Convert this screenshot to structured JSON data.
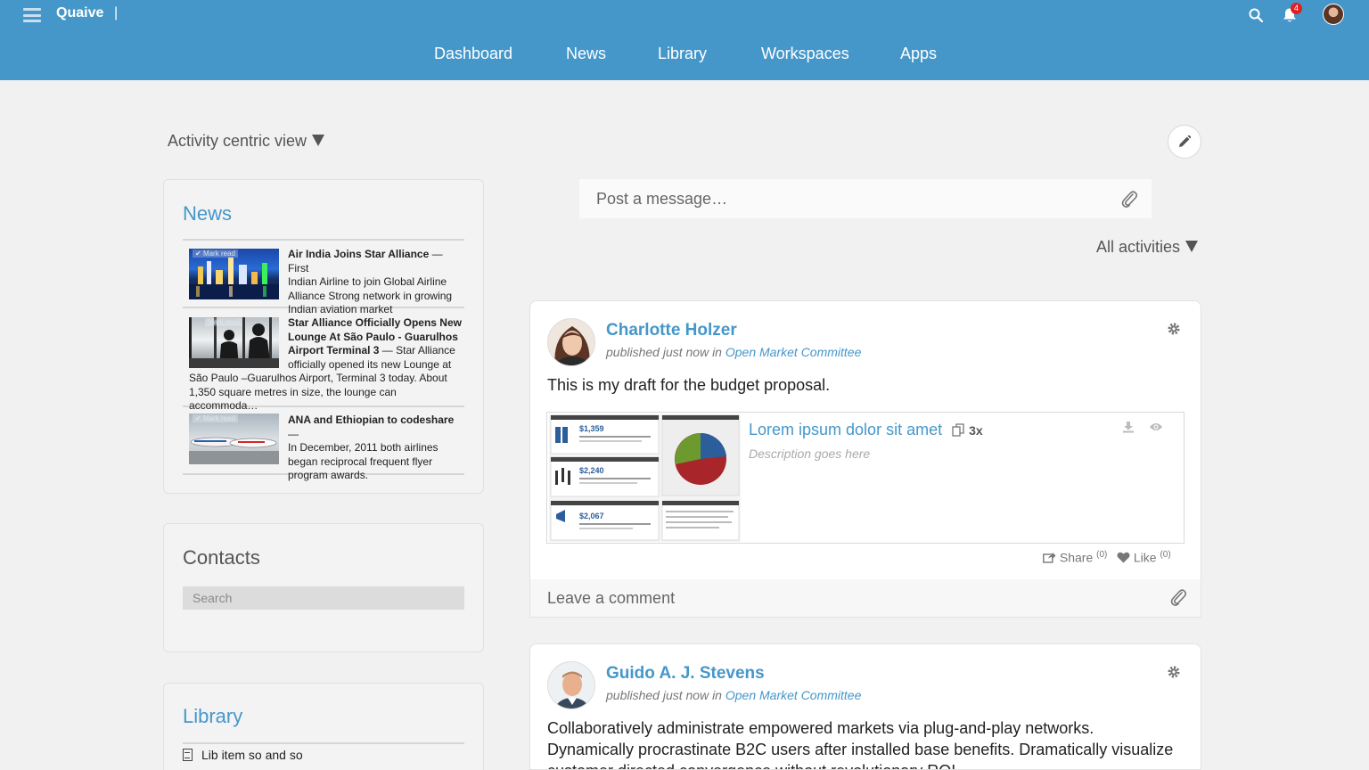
{
  "header": {
    "brand": "Quaive",
    "separator": "|",
    "notification_count": "4",
    "nav": [
      {
        "label": "Dashboard"
      },
      {
        "label": "News"
      },
      {
        "label": "Library"
      },
      {
        "label": "Workspaces"
      },
      {
        "label": "Apps"
      }
    ]
  },
  "left": {
    "view_selector": "Activity centric view",
    "news": {
      "title": "News",
      "mark_read": "Mark read",
      "items": [
        {
          "title": "Air India Joins Star Alliance",
          "dash": " — ",
          "body_lines": [
            "First",
            "Indian Airline to join Global Airline",
            "Alliance Strong network in growing",
            "Indian aviation market"
          ]
        },
        {
          "title_lines": [
            "Star Alliance Officially Opens New",
            "Lounge At São Paulo - Guarulhos",
            "Airport Terminal 3"
          ],
          "dash": " — ",
          "body_lines": [
            "Star Alliance",
            "officially opened its new Lounge at",
            "São Paulo –Guarulhos Airport, Terminal 3 today. About",
            "1,350 square metres in size, the lounge can accommoda…"
          ]
        },
        {
          "title": "ANA and Ethiopian to codeshare",
          "dash": " — ",
          "body_lines": [
            "In December, 2011 both airlines",
            "began reciprocal frequent flyer",
            "program awards."
          ]
        }
      ]
    },
    "contacts": {
      "title": "Contacts",
      "search_placeholder": "Search"
    },
    "library": {
      "title": "Library",
      "item": "Lib item so and so"
    }
  },
  "stream": {
    "post_placeholder": "Post a message…",
    "filter": "All activities",
    "posts": [
      {
        "author": "Charlotte Holzer",
        "meta_prefix": "published just now in ",
        "workspace": "Open Market Committee",
        "body": "This is my draft for the budget proposal.",
        "attachment": {
          "title": "Lorem ipsum dolor sit amet",
          "count": "3x",
          "description": "Description goes here",
          "preview_values": [
            "$1,359",
            "$2,240",
            "$2,067"
          ]
        },
        "share_label": "Share",
        "share_count": "(0)",
        "like_label": "Like",
        "like_count": "(0)",
        "comment_placeholder": "Leave a comment"
      },
      {
        "author": "Guido A. J. Stevens",
        "meta_prefix": "published just now in ",
        "workspace": "Open Market Committee",
        "body_lines": [
          "Collaboratively administrate empowered markets via plug-and-play networks.",
          "Dynamically procrastinate B2C users after installed base benefits. Dramatically visualize",
          "customer directed convergence without revolutionary ROI."
        ]
      }
    ]
  },
  "colors": {
    "header": "#4597ca",
    "accent": "#4597ca",
    "background": "#f1f1f1",
    "badge": "#e02020"
  },
  "icons": [
    "hamburger-icon",
    "search-icon",
    "bell-icon",
    "pencil-icon",
    "paperclip-icon",
    "gear-icon",
    "download-icon",
    "eye-icon",
    "share-icon",
    "heart-icon",
    "document-icon",
    "copies-icon"
  ]
}
